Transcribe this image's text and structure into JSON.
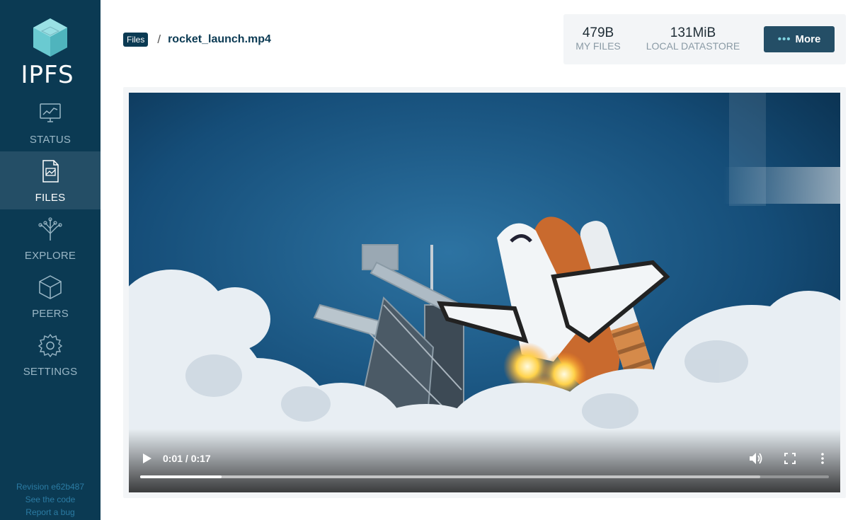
{
  "app": {
    "logo_text": "IPFS",
    "logo_icon": "cube-icon"
  },
  "sidebar": {
    "items": [
      {
        "label": "STATUS",
        "icon": "status-chart-icon",
        "active": false
      },
      {
        "label": "FILES",
        "icon": "files-document-icon",
        "active": true
      },
      {
        "label": "EXPLORE",
        "icon": "explore-tree-icon",
        "active": false
      },
      {
        "label": "PEERS",
        "icon": "peers-cube-icon",
        "active": false
      },
      {
        "label": "SETTINGS",
        "icon": "settings-gear-icon",
        "active": false
      }
    ],
    "footer": {
      "revision": "Revision e62b487",
      "see_code": "See the code",
      "report_bug": "Report a bug"
    }
  },
  "breadcrumb": {
    "root": "Files",
    "separator": "/",
    "file": "rocket_launch.mp4"
  },
  "stats": {
    "my_files_value": "479B",
    "my_files_label": "MY FILES",
    "datastore_value": "131MiB",
    "datastore_label": "LOCAL DATASTORE"
  },
  "more_button": {
    "label": "More",
    "icon": "ellipsis-icon"
  },
  "video": {
    "time": "0:01 / 0:17",
    "progress_fraction": 0.118,
    "buffered_fraction": 0.9
  },
  "colors": {
    "sidebar_bg": "#0b3a53",
    "sidebar_active": "#244e66",
    "accent_teal": "#6acad1",
    "navy": "#0b3a53"
  }
}
